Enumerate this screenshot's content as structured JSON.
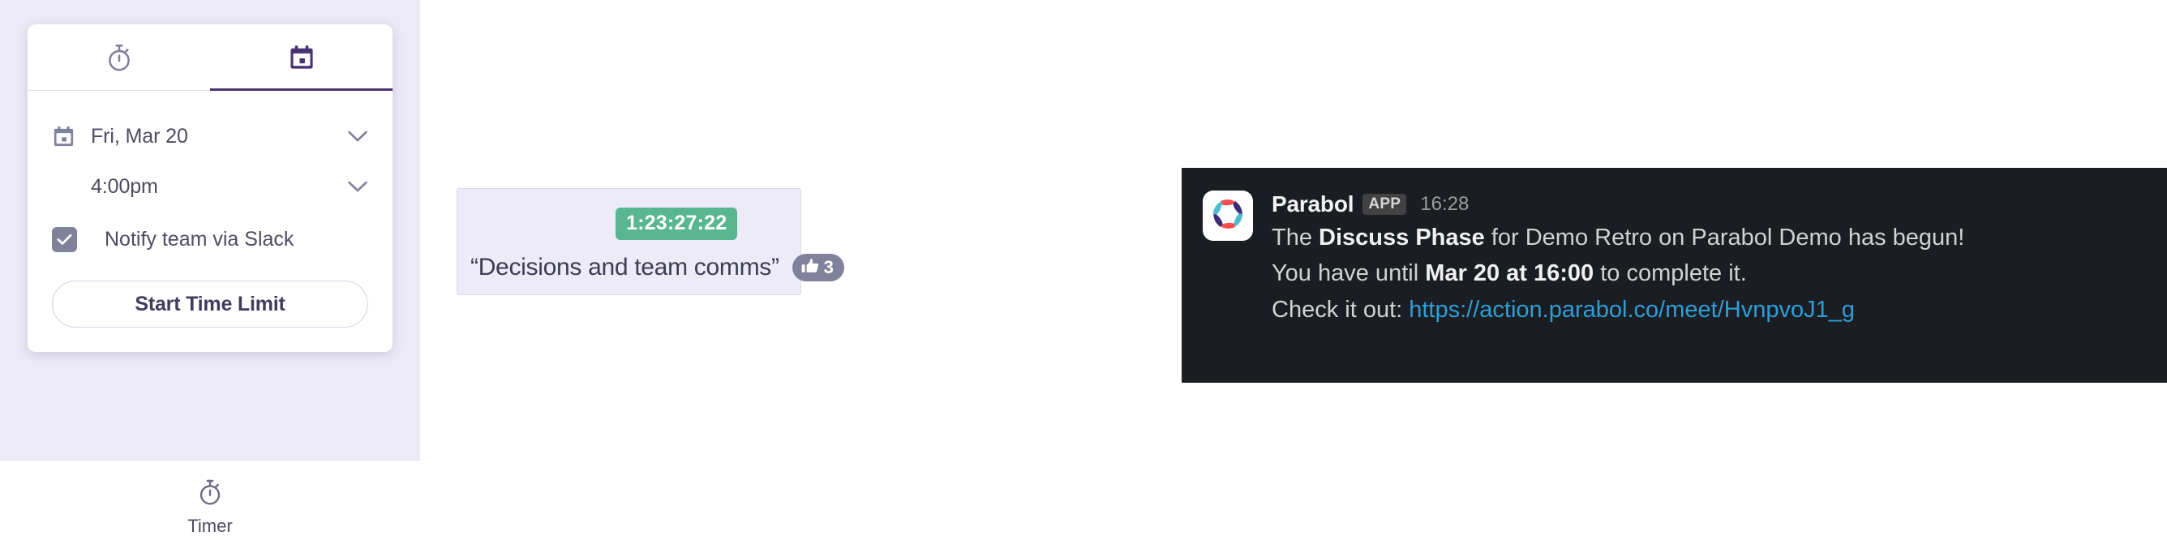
{
  "timer_panel": {
    "tabs": [
      {
        "name": "stopwatch-tab",
        "icon": "stopwatch-icon",
        "active": false
      },
      {
        "name": "calendar-tab",
        "icon": "calendar-icon",
        "active": true
      }
    ],
    "date_row": {
      "icon": "calendar-icon",
      "value": "Fri, Mar 20",
      "chevron": "chevron-down-icon"
    },
    "time_row": {
      "value": "4:00pm",
      "chevron": "chevron-down-icon"
    },
    "notify_row": {
      "label": "Notify team via Slack",
      "checked": true
    },
    "start_button": "Start Time Limit",
    "bottom_nav": {
      "icon": "stopwatch-icon",
      "label": "Timer"
    },
    "colors": {
      "panel_bg": "#ebeaf5",
      "active_tab": "#493272",
      "muted": "#82819c",
      "text": "#4c4c63"
    }
  },
  "discuss_card": {
    "timer_value": "1:23:27:22",
    "topic": "“Decisions and team comms”",
    "vote_count": "3",
    "vote_icon": "thumbs-up-icon",
    "colors": {
      "card_bg": "#edebf7",
      "timer_badge": "#58b790",
      "vote_pill": "#82819c"
    }
  },
  "slack_message": {
    "app_logo": "parabol-logo-icon",
    "author": "Parabol",
    "app_badge": "APP",
    "timestamp": "16:28",
    "line1": {
      "pre": "The ",
      "bold": "Discuss Phase",
      "post": " for Demo Retro on Parabol Demo has begun!"
    },
    "line2": {
      "pre": "You have until ",
      "bold": "Mar 20 at 16:00",
      "post": " to complete it."
    },
    "line3": {
      "pre": "Check it out: ",
      "link": "https://action.parabol.co/meet/HvnpvoJ1_g"
    },
    "colors": {
      "bg": "#1a1d21",
      "text": "#d1d2d3",
      "link": "#2d9ed8",
      "badge_bg": "#424242"
    }
  }
}
